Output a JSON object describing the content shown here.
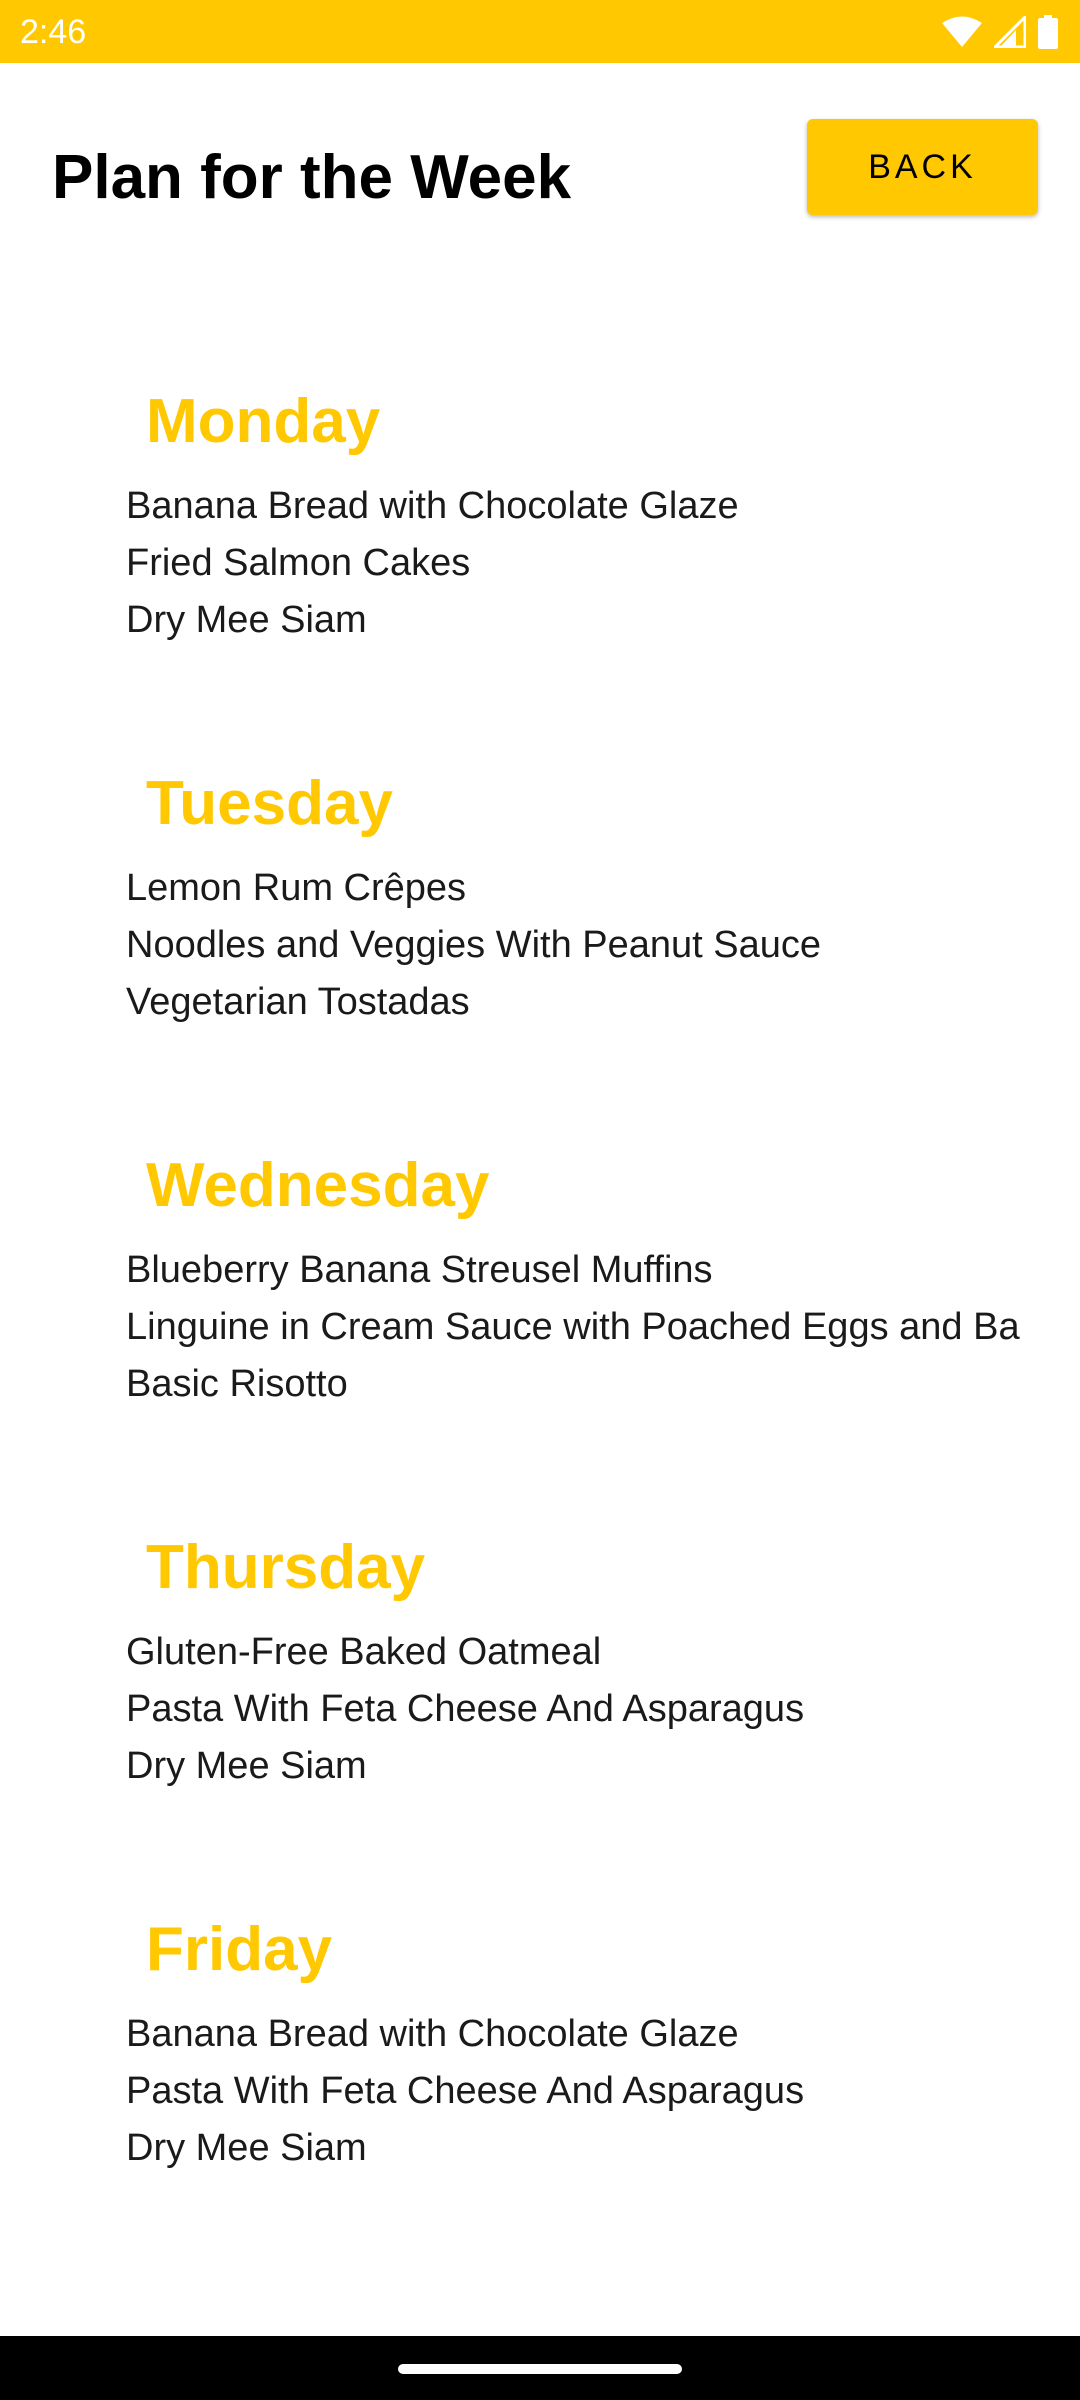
{
  "status_bar": {
    "time": "2:46",
    "icons": [
      "wifi-icon",
      "signal-icon",
      "battery-icon"
    ],
    "background_color": "#FFC800"
  },
  "header": {
    "title": "Plan for the Week",
    "back_label": "BACK"
  },
  "accent_color": "#FFC800",
  "days": [
    {
      "name": "Monday",
      "meals": [
        "Banana Bread with Chocolate Glaze",
        "Fried Salmon Cakes",
        "Dry Mee Siam"
      ]
    },
    {
      "name": "Tuesday",
      "meals": [
        "Lemon Rum Crêpes",
        "Noodles and Veggies With Peanut Sauce",
        "Vegetarian Tostadas"
      ]
    },
    {
      "name": "Wednesday",
      "meals": [
        "Blueberry Banana Streusel Muffins",
        "Linguine in Cream Sauce with Poached Eggs and Ba",
        "Basic Risotto"
      ]
    },
    {
      "name": "Thursday",
      "meals": [
        "Gluten-Free Baked Oatmeal",
        "Pasta With Feta Cheese And Asparagus",
        "Dry Mee Siam"
      ]
    },
    {
      "name": "Friday",
      "meals": [
        "Banana Bread with Chocolate Glaze",
        "Pasta With Feta Cheese And Asparagus",
        "Dry Mee Siam"
      ]
    }
  ]
}
